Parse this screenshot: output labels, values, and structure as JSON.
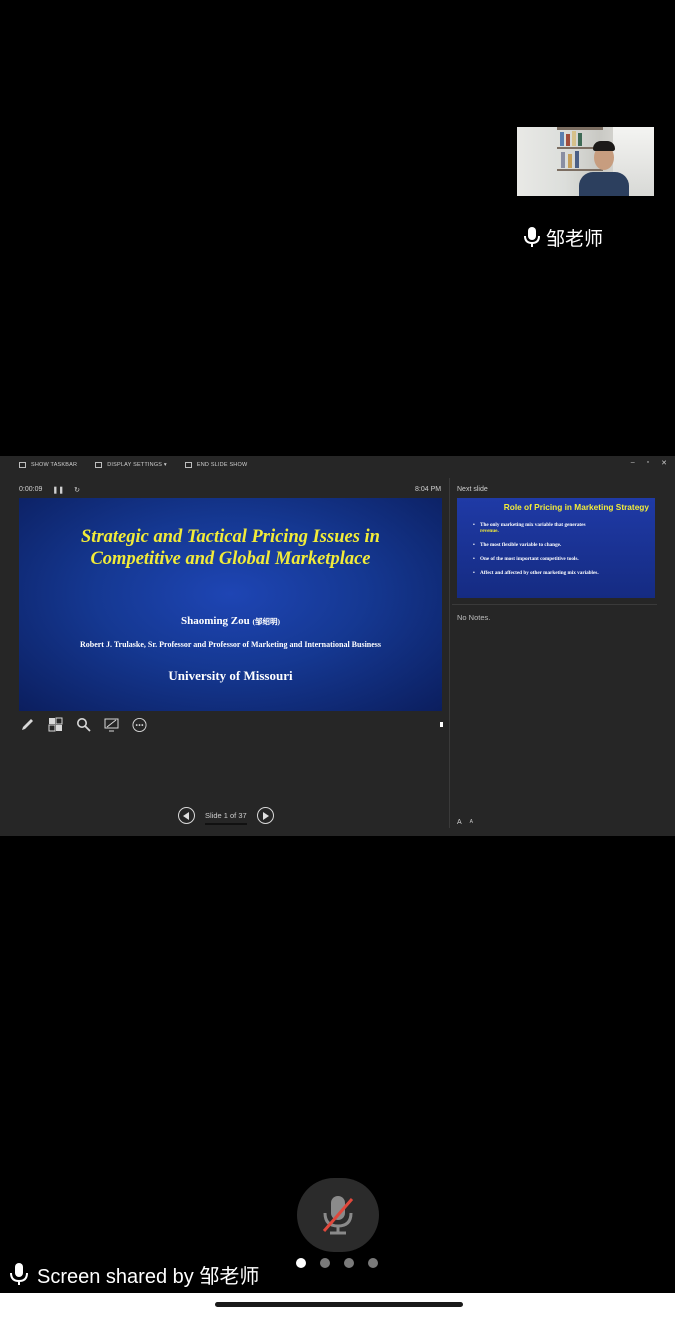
{
  "participant": {
    "name": "邹老师"
  },
  "presenter_view": {
    "toolbar": {
      "show_taskbar": "SHOW TASKBAR",
      "display_settings": "DISPLAY SETTINGS ▾",
      "end_slide_show": "END SLIDE SHOW"
    },
    "window_controls": [
      "–",
      "▫",
      "✕"
    ],
    "timer": "0:00:09",
    "clock": "8:04 PM",
    "current_slide": {
      "title_line1": "Strategic and Tactical Pricing Issues in",
      "title_line2": "Competitive and Global Marketplace",
      "author": "Shaoming Zou",
      "author_cn": "(邹绍明)",
      "position": "Robert J. Trulaske, Sr. Professor and Professor of Marketing and International Business",
      "university": "University of Missouri"
    },
    "next_slide_label": "Next slide",
    "next_slide": {
      "title": "Role of Pricing in Marketing Strategy",
      "bullet1_text": "The only marketing mix variable that generates",
      "bullet1_highlight": "revenue.",
      "bullet2": "The most flexible variable to change.",
      "bullet3": "One of the most important competitive tools.",
      "bullet4": "Affect and affected by other marketing mix variables."
    },
    "notes": "No Notes.",
    "slide_counter": "Slide 1 of 37",
    "font_buttons": [
      "A",
      "A"
    ],
    "tools": [
      "pen-icon",
      "slides-grid-icon",
      "zoom-icon",
      "display-icon",
      "more-icon"
    ]
  },
  "meeting": {
    "screen_share_text": "Screen shared by 邹老师",
    "page_dots": 4,
    "active_dot": 0,
    "mic_muted": true
  },
  "colors": {
    "slide_blue": "#153892",
    "slide_title_yellow": "#f2ec39",
    "panel_bg": "#262626"
  }
}
